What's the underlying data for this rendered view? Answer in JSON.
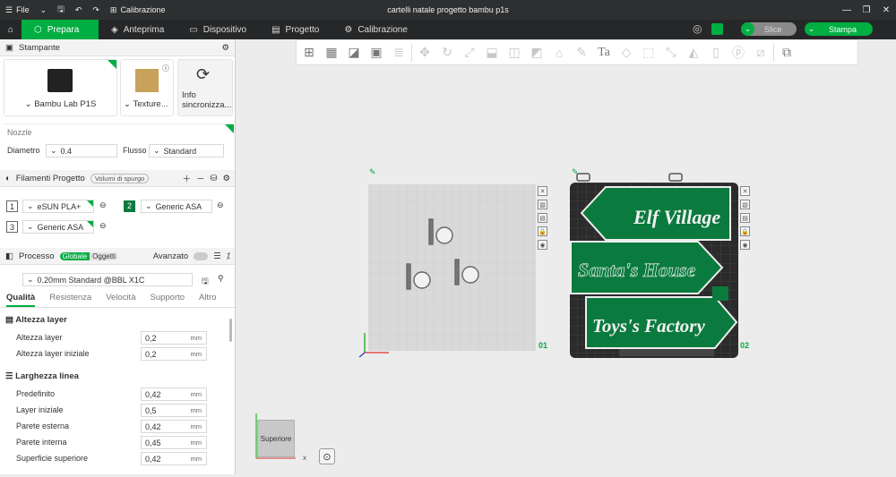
{
  "titlebar": {
    "file": "File",
    "calibration": "Calibrazione",
    "title": "cartelli natale progetto bambu p1s"
  },
  "tabs": [
    {
      "label": "Prepara"
    },
    {
      "label": "Anteprima"
    },
    {
      "label": "Dispositivo"
    },
    {
      "label": "Progetto"
    },
    {
      "label": "Calibrazione"
    }
  ],
  "actions": {
    "slice": "Slice",
    "print": "Stampa"
  },
  "printer": {
    "header": "Stampante",
    "model": "Bambu Lab P1S",
    "plate": "Texture...",
    "sync": "Info sincronizza..."
  },
  "nozzle": {
    "label": "Nozzle",
    "diameter_label": "Diametro",
    "diameter": "0.4",
    "flow_label": "Flusso",
    "flow": "Standard"
  },
  "filaments": {
    "header": "Filamenti Progetto",
    "purge": "Volumi di spurgo",
    "items": [
      {
        "num": "1",
        "name": "eSUN PLA+"
      },
      {
        "num": "2",
        "name": "Generic ASA"
      },
      {
        "num": "3",
        "name": "Generic ASA"
      }
    ]
  },
  "process": {
    "header": "Processo",
    "global": "Globale",
    "objects": "Oggetti",
    "advanced": "Avanzato",
    "profile": "0.20mm Standard @BBL X1C",
    "tabs": [
      "Qualità",
      "Resistenza",
      "Velocità",
      "Supporto",
      "Altro"
    ]
  },
  "layer": {
    "title": "Altezza layer",
    "rows": [
      {
        "label": "Altezza layer",
        "value": "0,2",
        "unit": "mm"
      },
      {
        "label": "Altezza layer iniziale",
        "value": "0,2",
        "unit": "mm"
      }
    ]
  },
  "linewidth": {
    "title": "Larghezza linea",
    "rows": [
      {
        "label": "Predefinito",
        "value": "0,42",
        "unit": "mm"
      },
      {
        "label": "Layer iniziale",
        "value": "0,5",
        "unit": "mm"
      },
      {
        "label": "Parete esterna",
        "value": "0,42",
        "unit": "mm"
      },
      {
        "label": "Parete interna",
        "value": "0,45",
        "unit": "mm"
      },
      {
        "label": "Superficie superiore",
        "value": "0,42",
        "unit": "mm"
      }
    ]
  },
  "plates": {
    "p1": "01",
    "p2": "02"
  },
  "signs": {
    "s1": "Elf Village",
    "s2": "Santa's House",
    "s3": "Toys's Factory"
  },
  "view": {
    "cube": "Superiore",
    "x": "x"
  },
  "colors": {
    "accent": "#00ae42",
    "sign_green": "#0b7a3e",
    "dark": "#2b2b2b"
  }
}
